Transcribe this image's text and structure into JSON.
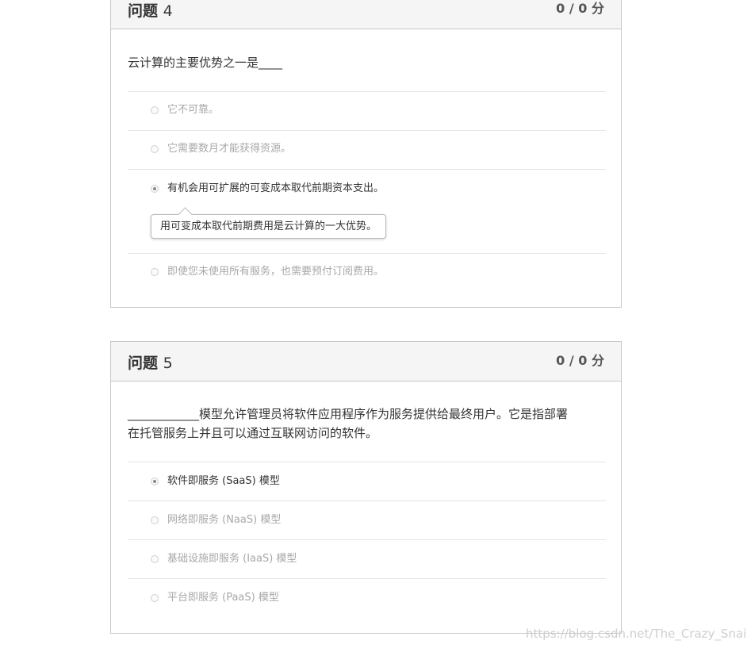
{
  "questions": [
    {
      "title": "问题",
      "number": "4",
      "score": "0 / 0 分",
      "prompt": "云计算的主要优势之一是____",
      "options": [
        {
          "label": "它不可靠。",
          "selected": false
        },
        {
          "label": "它需要数月才能获得资源。",
          "selected": false
        },
        {
          "label": "有机会用可扩展的可变成本取代前期资本支出。",
          "selected": true
        },
        {
          "label": "即使您未使用所有服务，也需要预付订阅费用。",
          "selected": false
        }
      ],
      "feedback": "用可变成本取代前期费用是云计算的一大优势。"
    },
    {
      "title": "问题",
      "number": "5",
      "score": "0 / 0 分",
      "prompt_line1": "____________模型允许管理员将软件应用程序作为服务提供给最终用户。它是指部署",
      "prompt_line2": "在托管服务上并且可以通过互联网访问的软件。",
      "options": [
        {
          "label": "软件即服务 (SaaS) 模型",
          "selected": true
        },
        {
          "label": "网络即服务 (NaaS) 模型",
          "selected": false
        },
        {
          "label": "基础设施即服务 (IaaS) 模型",
          "selected": false
        },
        {
          "label": "平台即服务 (PaaS) 模型",
          "selected": false
        }
      ]
    }
  ],
  "watermark": "https://blog.csdn.net/The_Crazy_Snail"
}
